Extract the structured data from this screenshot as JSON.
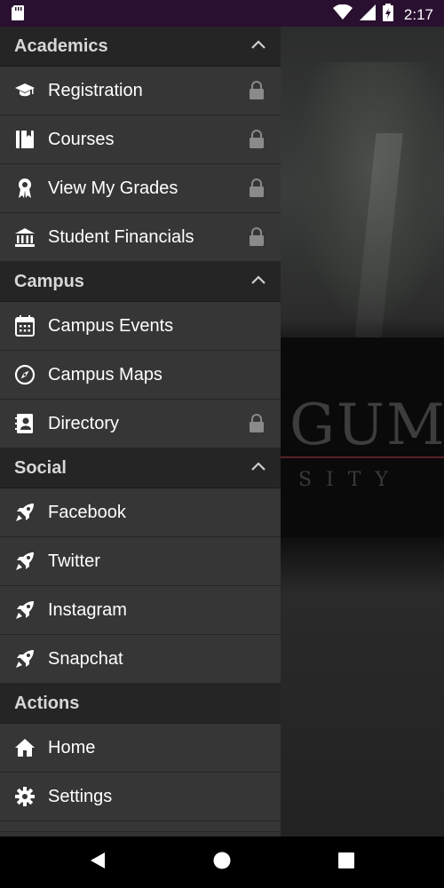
{
  "status_bar": {
    "time": "2:17"
  },
  "background": {
    "sign_text": "GUM",
    "sign_subtext": "SITY"
  },
  "drawer": {
    "sections": [
      {
        "title": "Academics",
        "items": [
          {
            "label": "Registration",
            "icon": "graduation-cap-icon",
            "locked": true
          },
          {
            "label": "Courses",
            "icon": "book-icon",
            "locked": true
          },
          {
            "label": "View My Grades",
            "icon": "award-ribbon-icon",
            "locked": true
          },
          {
            "label": "Student Financials",
            "icon": "bank-icon",
            "locked": true
          }
        ]
      },
      {
        "title": "Campus",
        "items": [
          {
            "label": "Campus Events",
            "icon": "calendar-icon",
            "locked": false
          },
          {
            "label": "Campus Maps",
            "icon": "compass-icon",
            "locked": false
          },
          {
            "label": "Directory",
            "icon": "contact-book-icon",
            "locked": true
          }
        ]
      },
      {
        "title": "Social",
        "items": [
          {
            "label": "Facebook",
            "icon": "rocket-icon",
            "locked": false
          },
          {
            "label": "Twitter",
            "icon": "rocket-icon",
            "locked": false
          },
          {
            "label": "Instagram",
            "icon": "rocket-icon",
            "locked": false
          },
          {
            "label": "Snapchat",
            "icon": "rocket-icon",
            "locked": false
          }
        ]
      },
      {
        "title": "Actions",
        "items": [
          {
            "label": "Home",
            "icon": "home-icon",
            "locked": false
          },
          {
            "label": "Settings",
            "icon": "gear-icon",
            "locked": false
          }
        ]
      }
    ]
  },
  "colors": {
    "drawer_bg": "#333333",
    "section_header_bg": "#252525",
    "status_bar_bg": "#2a1030"
  }
}
